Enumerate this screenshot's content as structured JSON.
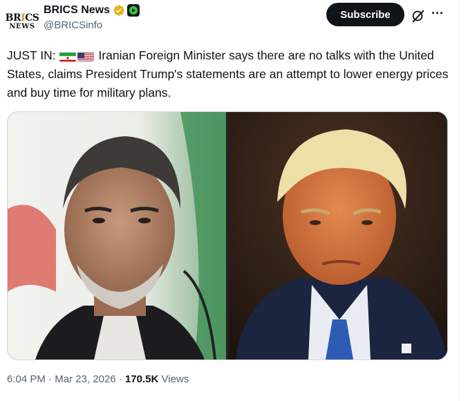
{
  "account": {
    "avatar_line1": "BRICS",
    "avatar_line2": "NEWS",
    "name": "BRICS News",
    "handle": "@BRICSinfo"
  },
  "actions": {
    "subscribe_label": "Subscribe",
    "grok_icon": "grok-icon",
    "more_icon": "more-icon"
  },
  "tweet": {
    "prefix": "JUST IN:",
    "flags": [
      "iran-flag-icon",
      "us-flag-icon"
    ],
    "body": "Iranian Foreign Minister says there are no talks with the United States, claims President Trump's statements are an attempt to lower energy prices and buy time for military plans."
  },
  "media": {
    "left_image": "Iranian Foreign Minister in front of Iranian flag",
    "right_image": "President Trump seated in courtroom"
  },
  "footer": {
    "time": "6:04 PM",
    "sep": "·",
    "date": "Mar 23, 2026",
    "views_count": "170.5K",
    "views_label": "Views"
  },
  "colors": {
    "text": "#0f1419",
    "muted": "#536471",
    "verified_gold": "#e2b719",
    "subscribe_bg": "#0f1419"
  }
}
